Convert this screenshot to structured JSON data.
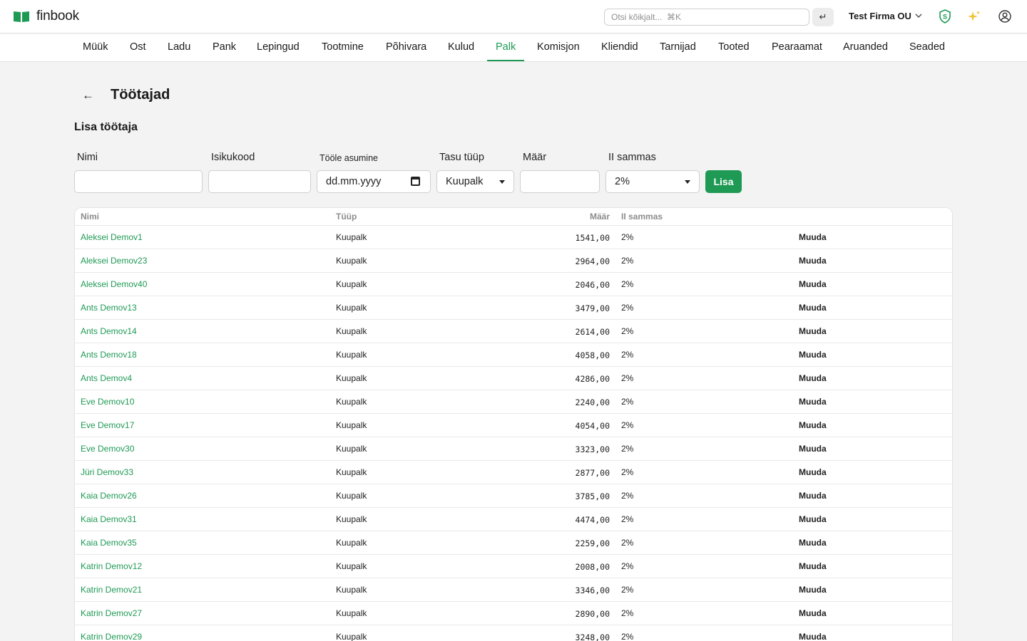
{
  "app": {
    "name": "finbook",
    "brand_color": "#1f9a55"
  },
  "header": {
    "search_placeholder": "Otsi kõikjalt...  ⌘K",
    "enter_icon": "↵",
    "company": "Test Firma OU",
    "icons": [
      "shield-s-icon",
      "sparkles-icon",
      "user-circle-icon"
    ]
  },
  "nav": {
    "items": [
      "Müük",
      "Ost",
      "Ladu",
      "Pank",
      "Lepingud",
      "Tootmine",
      "Põhivara",
      "Kulud",
      "Palk",
      "Komisjon",
      "Kliendid",
      "Tarnijad",
      "Tooted",
      "Pearaamat",
      "Aruanded",
      "Seaded"
    ],
    "active": "Palk"
  },
  "page": {
    "title": "Töötajad",
    "back_icon": "←"
  },
  "form": {
    "title": "Lisa töötaja",
    "name_label": "Nimi",
    "id_label": "Isikukood",
    "start_label": "Tööle asumine",
    "start_placeholder": "dd.mm.yyyy",
    "pay_type_label": "Tasu tüüp",
    "pay_type_value": "Kuupalk",
    "rate_label": "Määr",
    "pillar_label": "II sammas",
    "pillar_value": "2%",
    "submit_label": "Lisa"
  },
  "table": {
    "columns": [
      "Nimi",
      "Tüüp",
      "Määr",
      "II sammas"
    ],
    "edit_label": "Muuda",
    "rows": [
      [
        "Aleksei Demov1",
        "Kuupalk",
        "1541,00",
        "2%"
      ],
      [
        "Aleksei Demov23",
        "Kuupalk",
        "2964,00",
        "2%"
      ],
      [
        "Aleksei Demov40",
        "Kuupalk",
        "2046,00",
        "2%"
      ],
      [
        "Ants Demov13",
        "Kuupalk",
        "3479,00",
        "2%"
      ],
      [
        "Ants Demov14",
        "Kuupalk",
        "2614,00",
        "2%"
      ],
      [
        "Ants Demov18",
        "Kuupalk",
        "4058,00",
        "2%"
      ],
      [
        "Ants Demov4",
        "Kuupalk",
        "4286,00",
        "2%"
      ],
      [
        "Eve Demov10",
        "Kuupalk",
        "2240,00",
        "2%"
      ],
      [
        "Eve Demov17",
        "Kuupalk",
        "4054,00",
        "2%"
      ],
      [
        "Eve Demov30",
        "Kuupalk",
        "3323,00",
        "2%"
      ],
      [
        "Jüri Demov33",
        "Kuupalk",
        "2877,00",
        "2%"
      ],
      [
        "Kaia Demov26",
        "Kuupalk",
        "3785,00",
        "2%"
      ],
      [
        "Kaia Demov31",
        "Kuupalk",
        "4474,00",
        "2%"
      ],
      [
        "Kaia Demov35",
        "Kuupalk",
        "2259,00",
        "2%"
      ],
      [
        "Katrin Demov12",
        "Kuupalk",
        "2008,00",
        "2%"
      ],
      [
        "Katrin Demov21",
        "Kuupalk",
        "3346,00",
        "2%"
      ],
      [
        "Katrin Demov27",
        "Kuupalk",
        "2890,00",
        "2%"
      ],
      [
        "Katrin Demov29",
        "Kuupalk",
        "3248,00",
        "2%"
      ]
    ]
  }
}
